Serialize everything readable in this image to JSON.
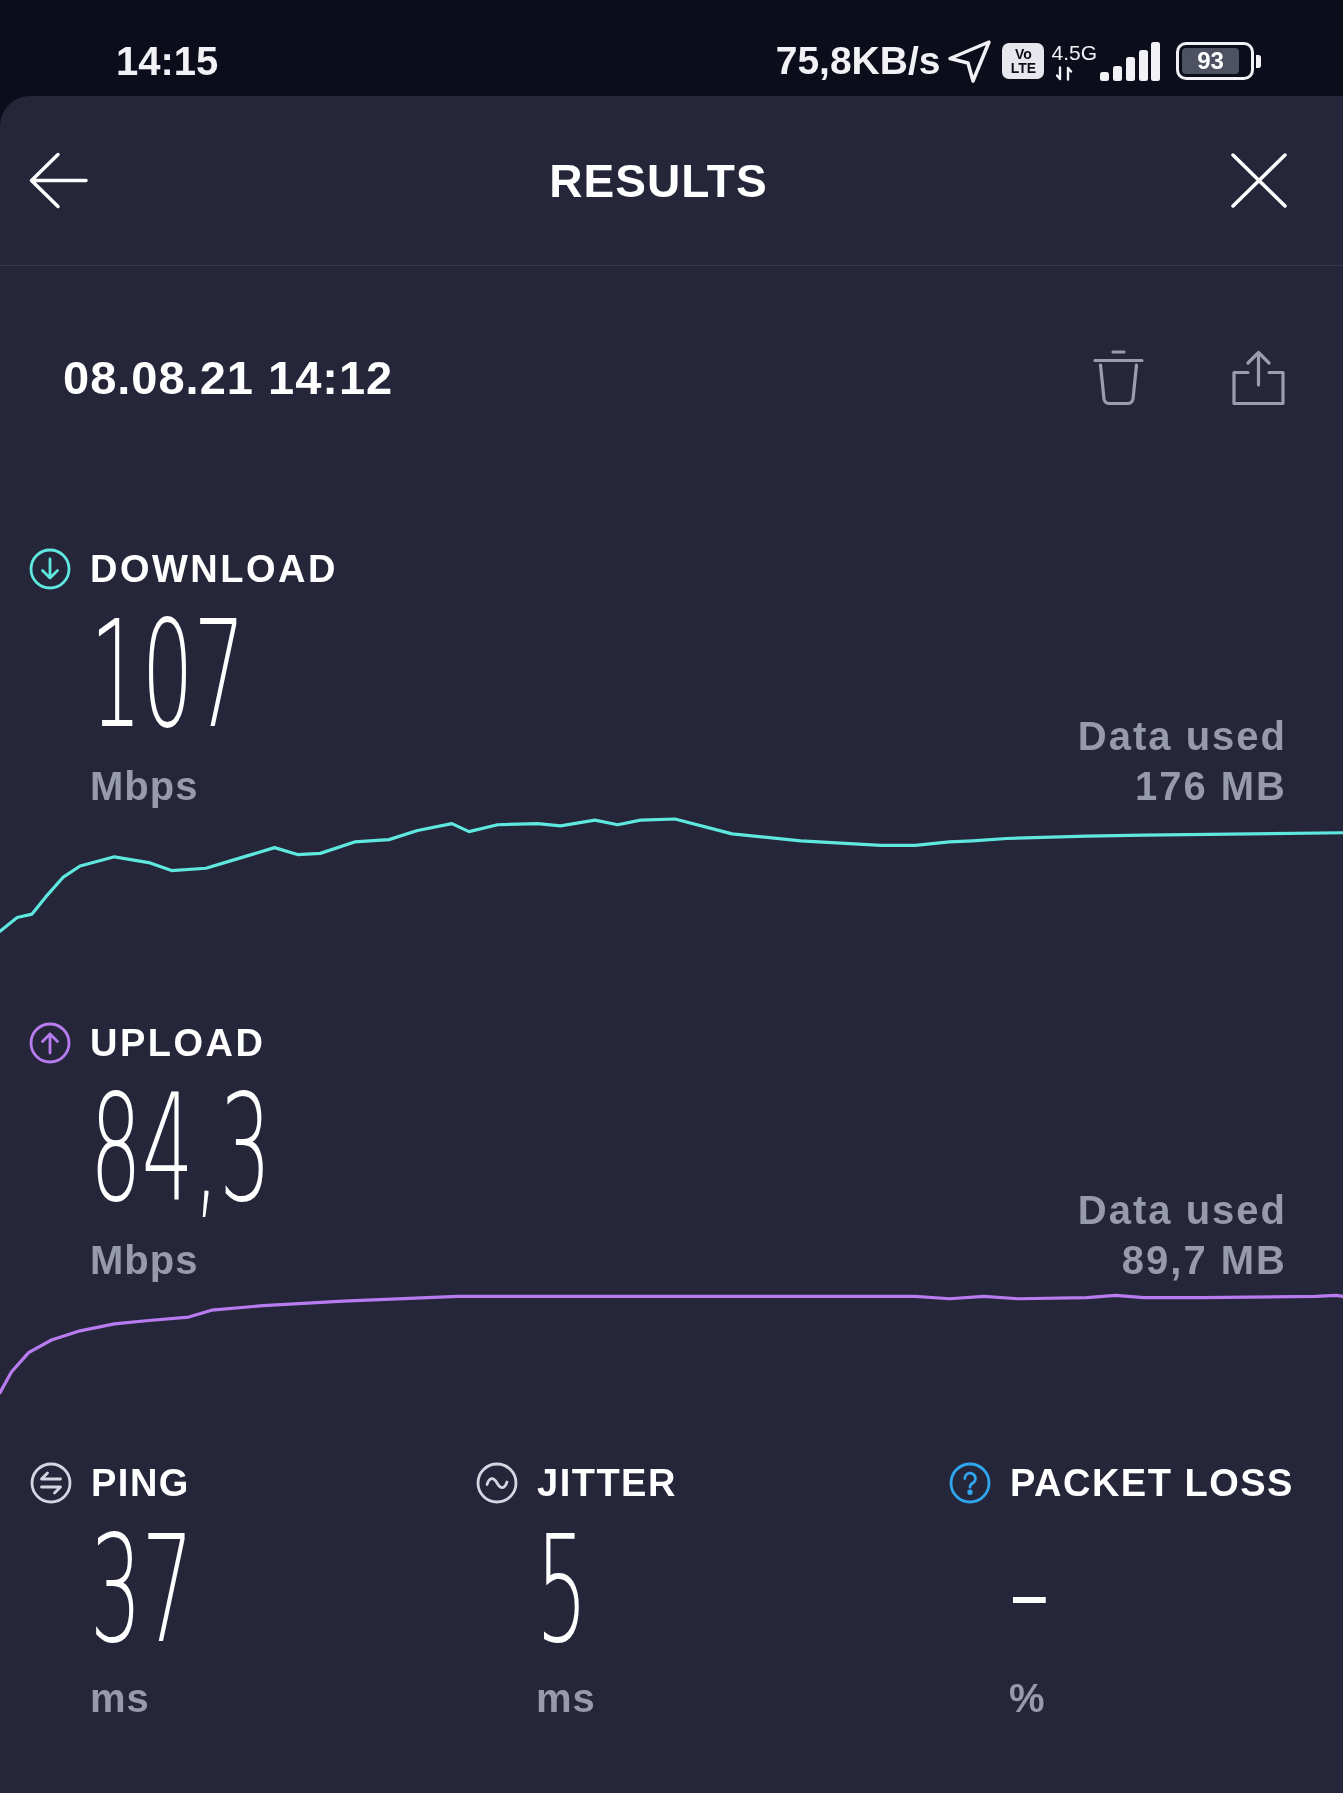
{
  "status_bar": {
    "time": "14:15",
    "network_speed": "75,8KB/s",
    "volte_badge": {
      "top": "Vo",
      "bottom": "LTE"
    },
    "network_type": "4.5G",
    "battery_percent": "93"
  },
  "header": {
    "title": "RESULTS"
  },
  "result": {
    "timestamp": "08.08.21 14:12"
  },
  "speeds": [
    {
      "kind": "download",
      "label": "DOWNLOAD",
      "color": "#5fe8e0",
      "value": "107",
      "unit": "Mbps",
      "data_used_label": "Data used",
      "data_used": "176 MB"
    },
    {
      "kind": "upload",
      "label": "UPLOAD",
      "color": "#b87cf0",
      "value": "84,3",
      "unit": "Mbps",
      "data_used_label": "Data used",
      "data_used": "89,7 MB"
    }
  ],
  "metrics": [
    {
      "kind": "ping",
      "label": "PING",
      "color": "#d4d6e2",
      "value": "37",
      "unit": "ms"
    },
    {
      "kind": "jitter",
      "label": "JITTER",
      "color": "#d4d6e2",
      "value": "5",
      "unit": "ms"
    },
    {
      "kind": "packet_loss",
      "label": "PACKET LOSS",
      "color": "#2fa6ee",
      "value": "–",
      "unit": "%"
    }
  ]
}
